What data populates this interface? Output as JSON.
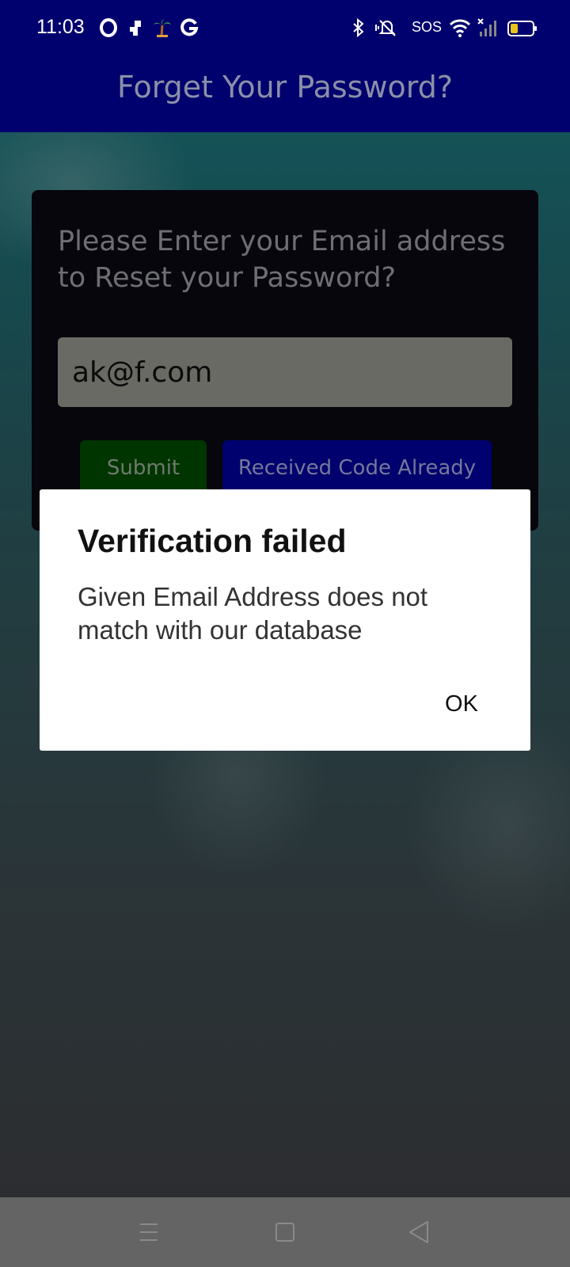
{
  "status_bar": {
    "time": "11:03",
    "sos": "SOS",
    "icons": [
      "opera-icon",
      "notification-icon",
      "palm-tree-icon",
      "google-icon",
      "bluetooth-icon",
      "vibrate-icon",
      "wifi-icon",
      "signal-icon",
      "battery-icon"
    ]
  },
  "app_bar": {
    "title": "Forget Your Password?"
  },
  "form": {
    "prompt": "Please Enter your Email address to Reset your Password?",
    "email_value": "ak@f.com",
    "submit_label": "Submit",
    "received_label": "Received Code Already"
  },
  "dialog": {
    "title": "Verification failed",
    "message": "Given Email Address does not match with our database",
    "ok_label": "OK"
  },
  "nav_bar": {
    "icons": [
      "menu-icon",
      "home-icon",
      "back-icon"
    ]
  },
  "colors": {
    "app_bar": "#00006e",
    "submit_button": "#003500",
    "received_button": "#00006e",
    "battery": "#e8c51c"
  }
}
